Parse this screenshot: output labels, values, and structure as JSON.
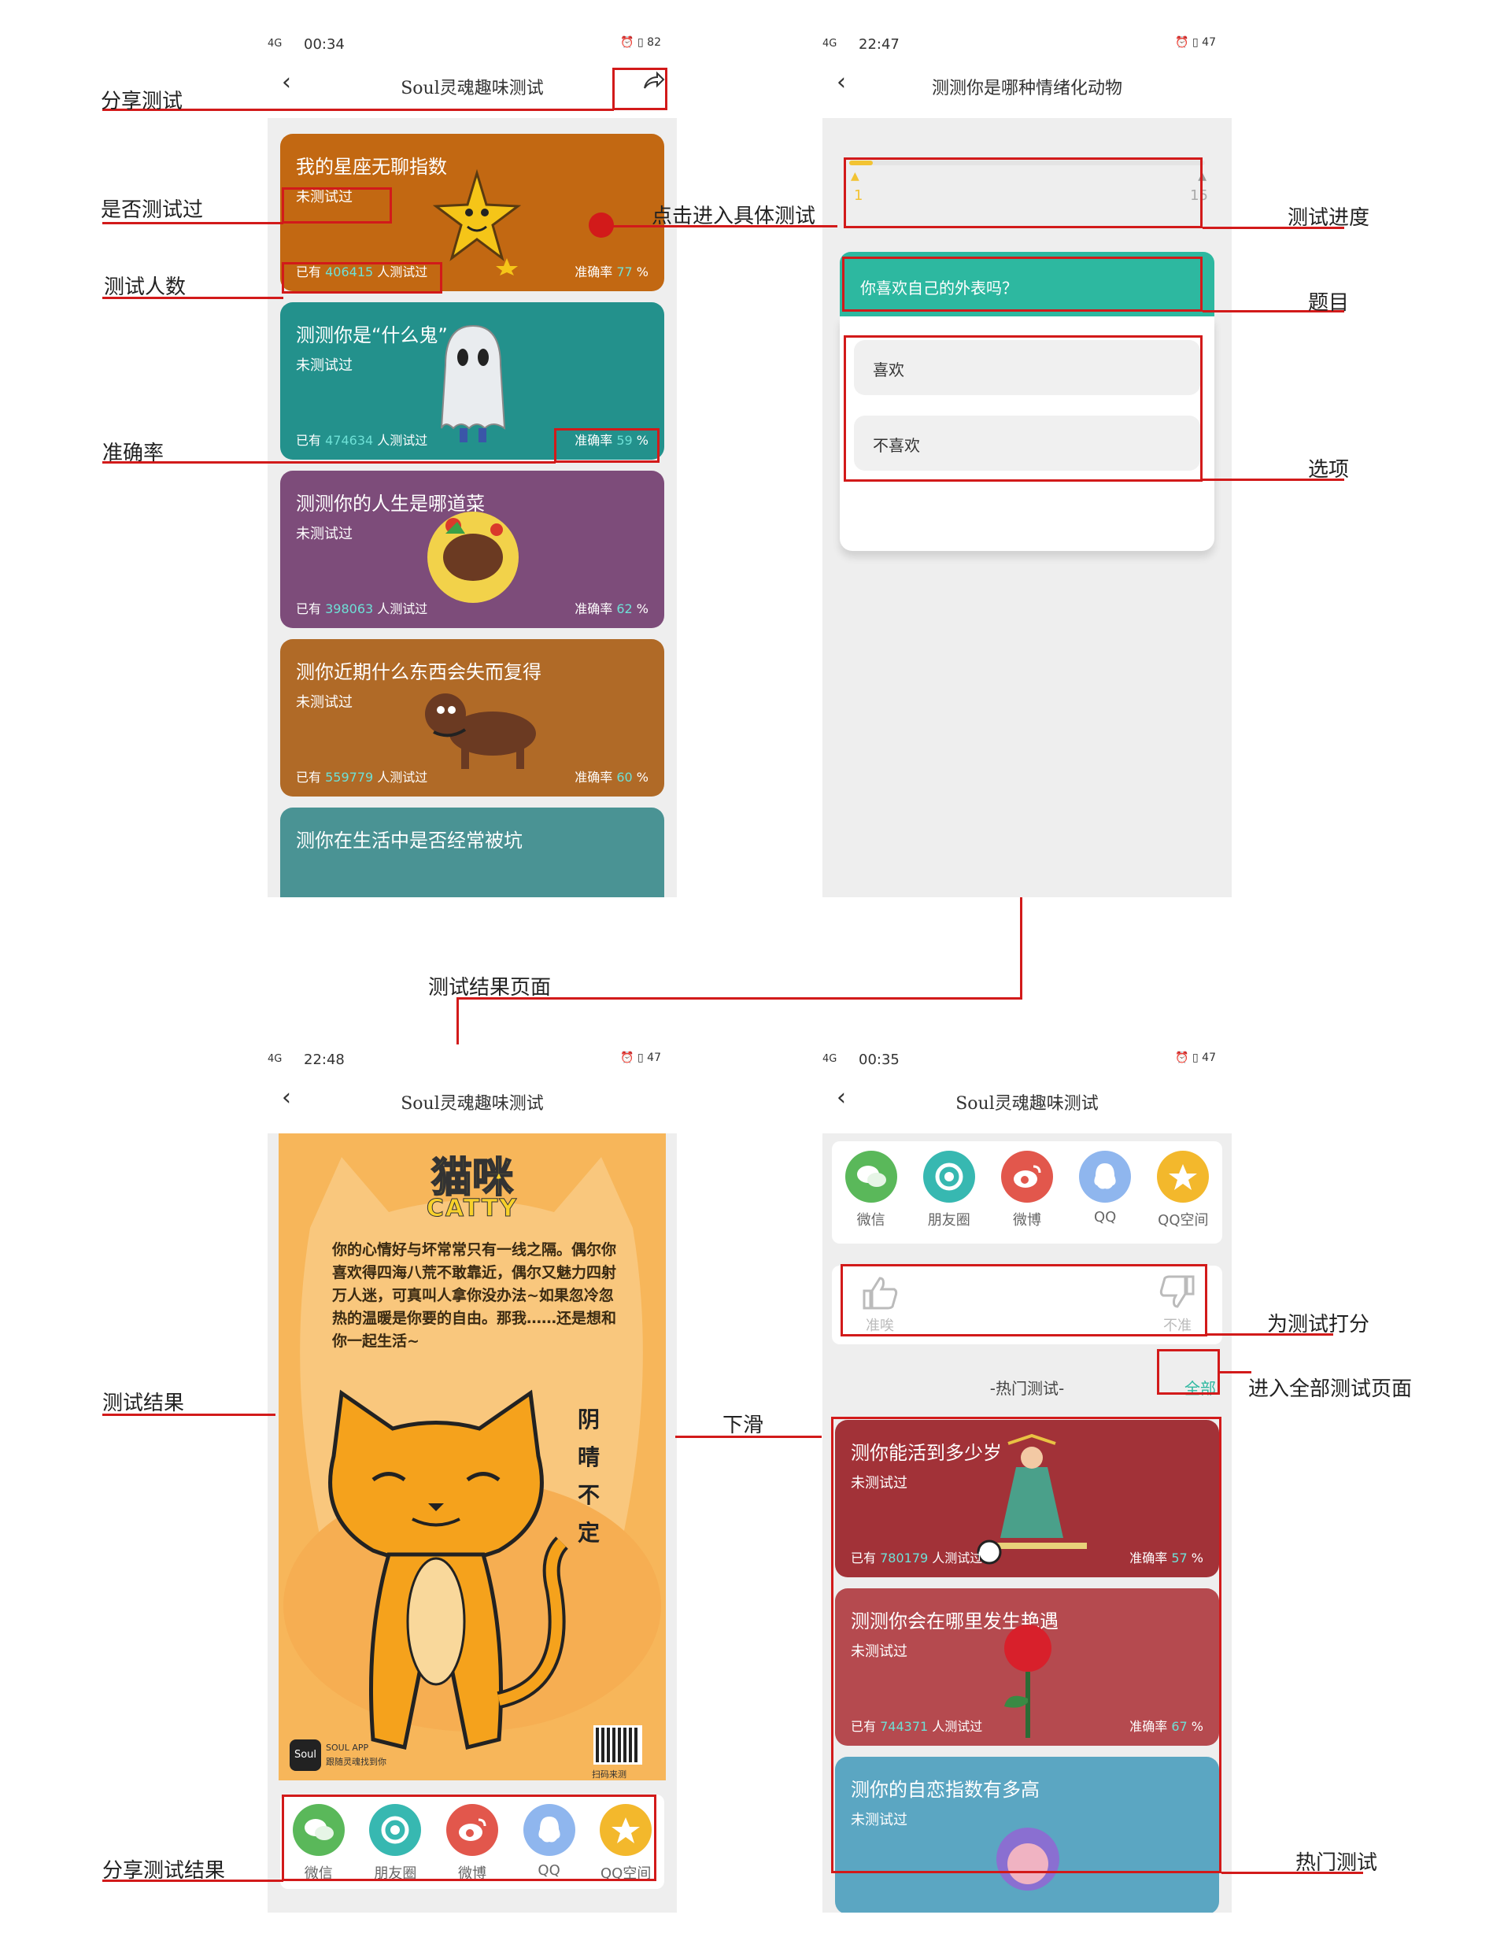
{
  "status": {
    "p1_time": "00:34",
    "p2_time": "22:47",
    "p3_time": "22:48",
    "p4_time": "00:35",
    "signal": "4G",
    "battery_p1": "82",
    "battery_p2": "47",
    "battery_p3": "47",
    "battery_p4": "47"
  },
  "nav": {
    "back_icon": "‹",
    "title": "Soul灵魂趣味测试",
    "quiz_title": "测测你是哪种情绪化动物"
  },
  "list_cards": [
    {
      "title": "我的星座无聊指数",
      "status": "未测试过",
      "count_prefix": "已有",
      "count": "406415",
      "count_suffix": "人测试过",
      "acc_prefix": "准确率",
      "acc": "77",
      "acc_suffix": "%",
      "color": "#c26812"
    },
    {
      "title": "测测你是“什么鬼”",
      "status": "未测试过",
      "count_prefix": "已有",
      "count": "474634",
      "count_suffix": "人测试过",
      "acc_prefix": "准确率",
      "acc": "59",
      "acc_suffix": "%",
      "color": "#23918c"
    },
    {
      "title": "测测你的人生是哪道菜",
      "status": "未测试过",
      "count_prefix": "已有",
      "count": "398063",
      "count_suffix": "人测试过",
      "acc_prefix": "准确率",
      "acc": "62",
      "acc_suffix": "%",
      "color": "#7d4c7a"
    },
    {
      "title": "测你近期什么东西会失而复得",
      "status": "未测试过",
      "count_prefix": "已有",
      "count": "559779",
      "count_suffix": "人测试过",
      "acc_prefix": "准确率",
      "acc": "60",
      "acc_suffix": "%",
      "color": "#b06a27"
    },
    {
      "title": "测你在生活中是否经常被坑",
      "color": "#4a9394"
    }
  ],
  "quiz": {
    "progress_current": "1",
    "progress_total": "15",
    "progress_fraction": 0.0667,
    "question": "你喜欢自己的外表吗？",
    "options": [
      "喜欢",
      "不喜欢"
    ]
  },
  "result": {
    "title_cn": "猫咪",
    "title_en": "CATTY",
    "body": "你的心情好与坏常常只有一线之隔。偶尔你喜欢得四海八荒不敢靠近，偶尔又魅力四射万人迷，可真叫人拿你没办法~如果忽冷忽热的温暖是你要的自由。那我……还是想和你一起生活~",
    "side_text": "阴晴不定",
    "brand": "Soul",
    "brand_sub": "SOUL APP",
    "brand_sub2": "跟随灵魂找到你",
    "qr_caption": "扫码来测"
  },
  "share_items": [
    {
      "label": "微信",
      "icon": "wechat-icon",
      "color": "#5ab85a"
    },
    {
      "label": "朋友圈",
      "icon": "moments-icon",
      "color": "#37b8b1"
    },
    {
      "label": "微博",
      "icon": "weibo-icon",
      "color": "#e2574c"
    },
    {
      "label": "QQ",
      "icon": "qq-icon",
      "color": "#8fb6ee"
    },
    {
      "label": "QQ空间",
      "icon": "qzone-icon",
      "color": "#f3b82c"
    }
  ],
  "rating": {
    "like_label": "准唉",
    "dislike_label": "不准"
  },
  "hot": {
    "header": "-热门测试-",
    "all_label": "全部",
    "cards": [
      {
        "title": "测你能活到多少岁",
        "status": "未测试过",
        "count_prefix": "已有",
        "count": "780179",
        "count_suffix": "人测试过",
        "acc_prefix": "准确率",
        "acc": "57",
        "acc_suffix": "%",
        "color": "#a23238"
      },
      {
        "title": "测测你会在哪里发生艳遇",
        "status": "未测试过",
        "count_prefix": "已有",
        "count": "744371",
        "count_suffix": "人测试过",
        "acc_prefix": "准确率",
        "acc": "67",
        "acc_suffix": "%",
        "color": "#b54a4f"
      },
      {
        "title": "测你的自恋指数有多高",
        "status": "未测试过",
        "color": "#5ba6c2"
      }
    ]
  },
  "annotations": {
    "share_test": "分享测试",
    "tested_or_not": "是否测试过",
    "test_count": "测试人数",
    "accuracy": "准确率",
    "click_enter": "点击进入具体测试",
    "progress": "测试进度",
    "question": "题目",
    "options": "选项",
    "result_page": "测试结果页面",
    "result": "测试结果",
    "swipe_down": "下滑",
    "share_result": "分享测试结果",
    "rate_test": "为测试打分",
    "enter_all": "进入全部测试页面",
    "hot_tests": "热门测试"
  }
}
